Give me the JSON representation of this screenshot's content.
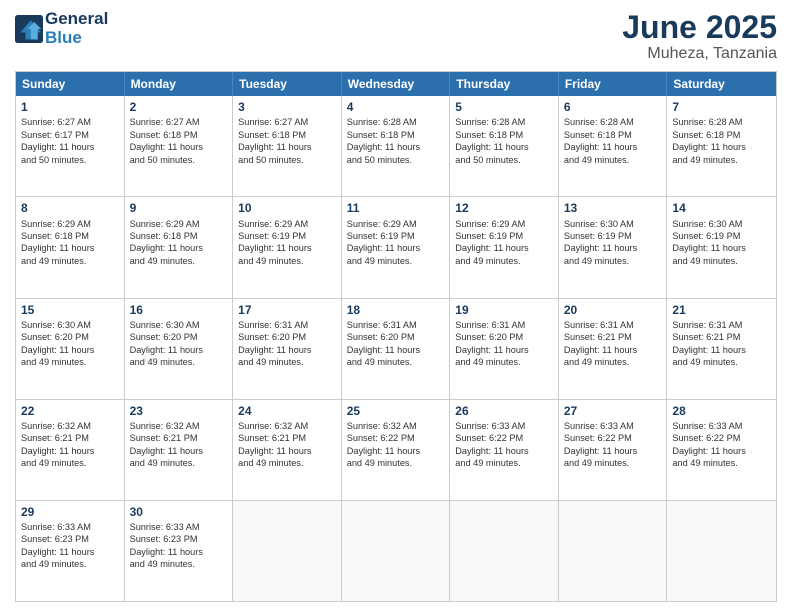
{
  "header": {
    "logo_line1": "General",
    "logo_line2": "Blue",
    "month": "June 2025",
    "location": "Muheza, Tanzania"
  },
  "weekdays": [
    "Sunday",
    "Monday",
    "Tuesday",
    "Wednesday",
    "Thursday",
    "Friday",
    "Saturday"
  ],
  "rows": [
    [
      {
        "day": "1",
        "lines": [
          "Sunrise: 6:27 AM",
          "Sunset: 6:17 PM",
          "Daylight: 11 hours",
          "and 50 minutes."
        ]
      },
      {
        "day": "2",
        "lines": [
          "Sunrise: 6:27 AM",
          "Sunset: 6:18 PM",
          "Daylight: 11 hours",
          "and 50 minutes."
        ]
      },
      {
        "day": "3",
        "lines": [
          "Sunrise: 6:27 AM",
          "Sunset: 6:18 PM",
          "Daylight: 11 hours",
          "and 50 minutes."
        ]
      },
      {
        "day": "4",
        "lines": [
          "Sunrise: 6:28 AM",
          "Sunset: 6:18 PM",
          "Daylight: 11 hours",
          "and 50 minutes."
        ]
      },
      {
        "day": "5",
        "lines": [
          "Sunrise: 6:28 AM",
          "Sunset: 6:18 PM",
          "Daylight: 11 hours",
          "and 50 minutes."
        ]
      },
      {
        "day": "6",
        "lines": [
          "Sunrise: 6:28 AM",
          "Sunset: 6:18 PM",
          "Daylight: 11 hours",
          "and 49 minutes."
        ]
      },
      {
        "day": "7",
        "lines": [
          "Sunrise: 6:28 AM",
          "Sunset: 6:18 PM",
          "Daylight: 11 hours",
          "and 49 minutes."
        ]
      }
    ],
    [
      {
        "day": "8",
        "lines": [
          "Sunrise: 6:29 AM",
          "Sunset: 6:18 PM",
          "Daylight: 11 hours",
          "and 49 minutes."
        ]
      },
      {
        "day": "9",
        "lines": [
          "Sunrise: 6:29 AM",
          "Sunset: 6:18 PM",
          "Daylight: 11 hours",
          "and 49 minutes."
        ]
      },
      {
        "day": "10",
        "lines": [
          "Sunrise: 6:29 AM",
          "Sunset: 6:19 PM",
          "Daylight: 11 hours",
          "and 49 minutes."
        ]
      },
      {
        "day": "11",
        "lines": [
          "Sunrise: 6:29 AM",
          "Sunset: 6:19 PM",
          "Daylight: 11 hours",
          "and 49 minutes."
        ]
      },
      {
        "day": "12",
        "lines": [
          "Sunrise: 6:29 AM",
          "Sunset: 6:19 PM",
          "Daylight: 11 hours",
          "and 49 minutes."
        ]
      },
      {
        "day": "13",
        "lines": [
          "Sunrise: 6:30 AM",
          "Sunset: 6:19 PM",
          "Daylight: 11 hours",
          "and 49 minutes."
        ]
      },
      {
        "day": "14",
        "lines": [
          "Sunrise: 6:30 AM",
          "Sunset: 6:19 PM",
          "Daylight: 11 hours",
          "and 49 minutes."
        ]
      }
    ],
    [
      {
        "day": "15",
        "lines": [
          "Sunrise: 6:30 AM",
          "Sunset: 6:20 PM",
          "Daylight: 11 hours",
          "and 49 minutes."
        ]
      },
      {
        "day": "16",
        "lines": [
          "Sunrise: 6:30 AM",
          "Sunset: 6:20 PM",
          "Daylight: 11 hours",
          "and 49 minutes."
        ]
      },
      {
        "day": "17",
        "lines": [
          "Sunrise: 6:31 AM",
          "Sunset: 6:20 PM",
          "Daylight: 11 hours",
          "and 49 minutes."
        ]
      },
      {
        "day": "18",
        "lines": [
          "Sunrise: 6:31 AM",
          "Sunset: 6:20 PM",
          "Daylight: 11 hours",
          "and 49 minutes."
        ]
      },
      {
        "day": "19",
        "lines": [
          "Sunrise: 6:31 AM",
          "Sunset: 6:20 PM",
          "Daylight: 11 hours",
          "and 49 minutes."
        ]
      },
      {
        "day": "20",
        "lines": [
          "Sunrise: 6:31 AM",
          "Sunset: 6:21 PM",
          "Daylight: 11 hours",
          "and 49 minutes."
        ]
      },
      {
        "day": "21",
        "lines": [
          "Sunrise: 6:31 AM",
          "Sunset: 6:21 PM",
          "Daylight: 11 hours",
          "and 49 minutes."
        ]
      }
    ],
    [
      {
        "day": "22",
        "lines": [
          "Sunrise: 6:32 AM",
          "Sunset: 6:21 PM",
          "Daylight: 11 hours",
          "and 49 minutes."
        ]
      },
      {
        "day": "23",
        "lines": [
          "Sunrise: 6:32 AM",
          "Sunset: 6:21 PM",
          "Daylight: 11 hours",
          "and 49 minutes."
        ]
      },
      {
        "day": "24",
        "lines": [
          "Sunrise: 6:32 AM",
          "Sunset: 6:21 PM",
          "Daylight: 11 hours",
          "and 49 minutes."
        ]
      },
      {
        "day": "25",
        "lines": [
          "Sunrise: 6:32 AM",
          "Sunset: 6:22 PM",
          "Daylight: 11 hours",
          "and 49 minutes."
        ]
      },
      {
        "day": "26",
        "lines": [
          "Sunrise: 6:33 AM",
          "Sunset: 6:22 PM",
          "Daylight: 11 hours",
          "and 49 minutes."
        ]
      },
      {
        "day": "27",
        "lines": [
          "Sunrise: 6:33 AM",
          "Sunset: 6:22 PM",
          "Daylight: 11 hours",
          "and 49 minutes."
        ]
      },
      {
        "day": "28",
        "lines": [
          "Sunrise: 6:33 AM",
          "Sunset: 6:22 PM",
          "Daylight: 11 hours",
          "and 49 minutes."
        ]
      }
    ],
    [
      {
        "day": "29",
        "lines": [
          "Sunrise: 6:33 AM",
          "Sunset: 6:23 PM",
          "Daylight: 11 hours",
          "and 49 minutes."
        ]
      },
      {
        "day": "30",
        "lines": [
          "Sunrise: 6:33 AM",
          "Sunset: 6:23 PM",
          "Daylight: 11 hours",
          "and 49 minutes."
        ]
      },
      {
        "day": "",
        "lines": []
      },
      {
        "day": "",
        "lines": []
      },
      {
        "day": "",
        "lines": []
      },
      {
        "day": "",
        "lines": []
      },
      {
        "day": "",
        "lines": []
      }
    ]
  ]
}
